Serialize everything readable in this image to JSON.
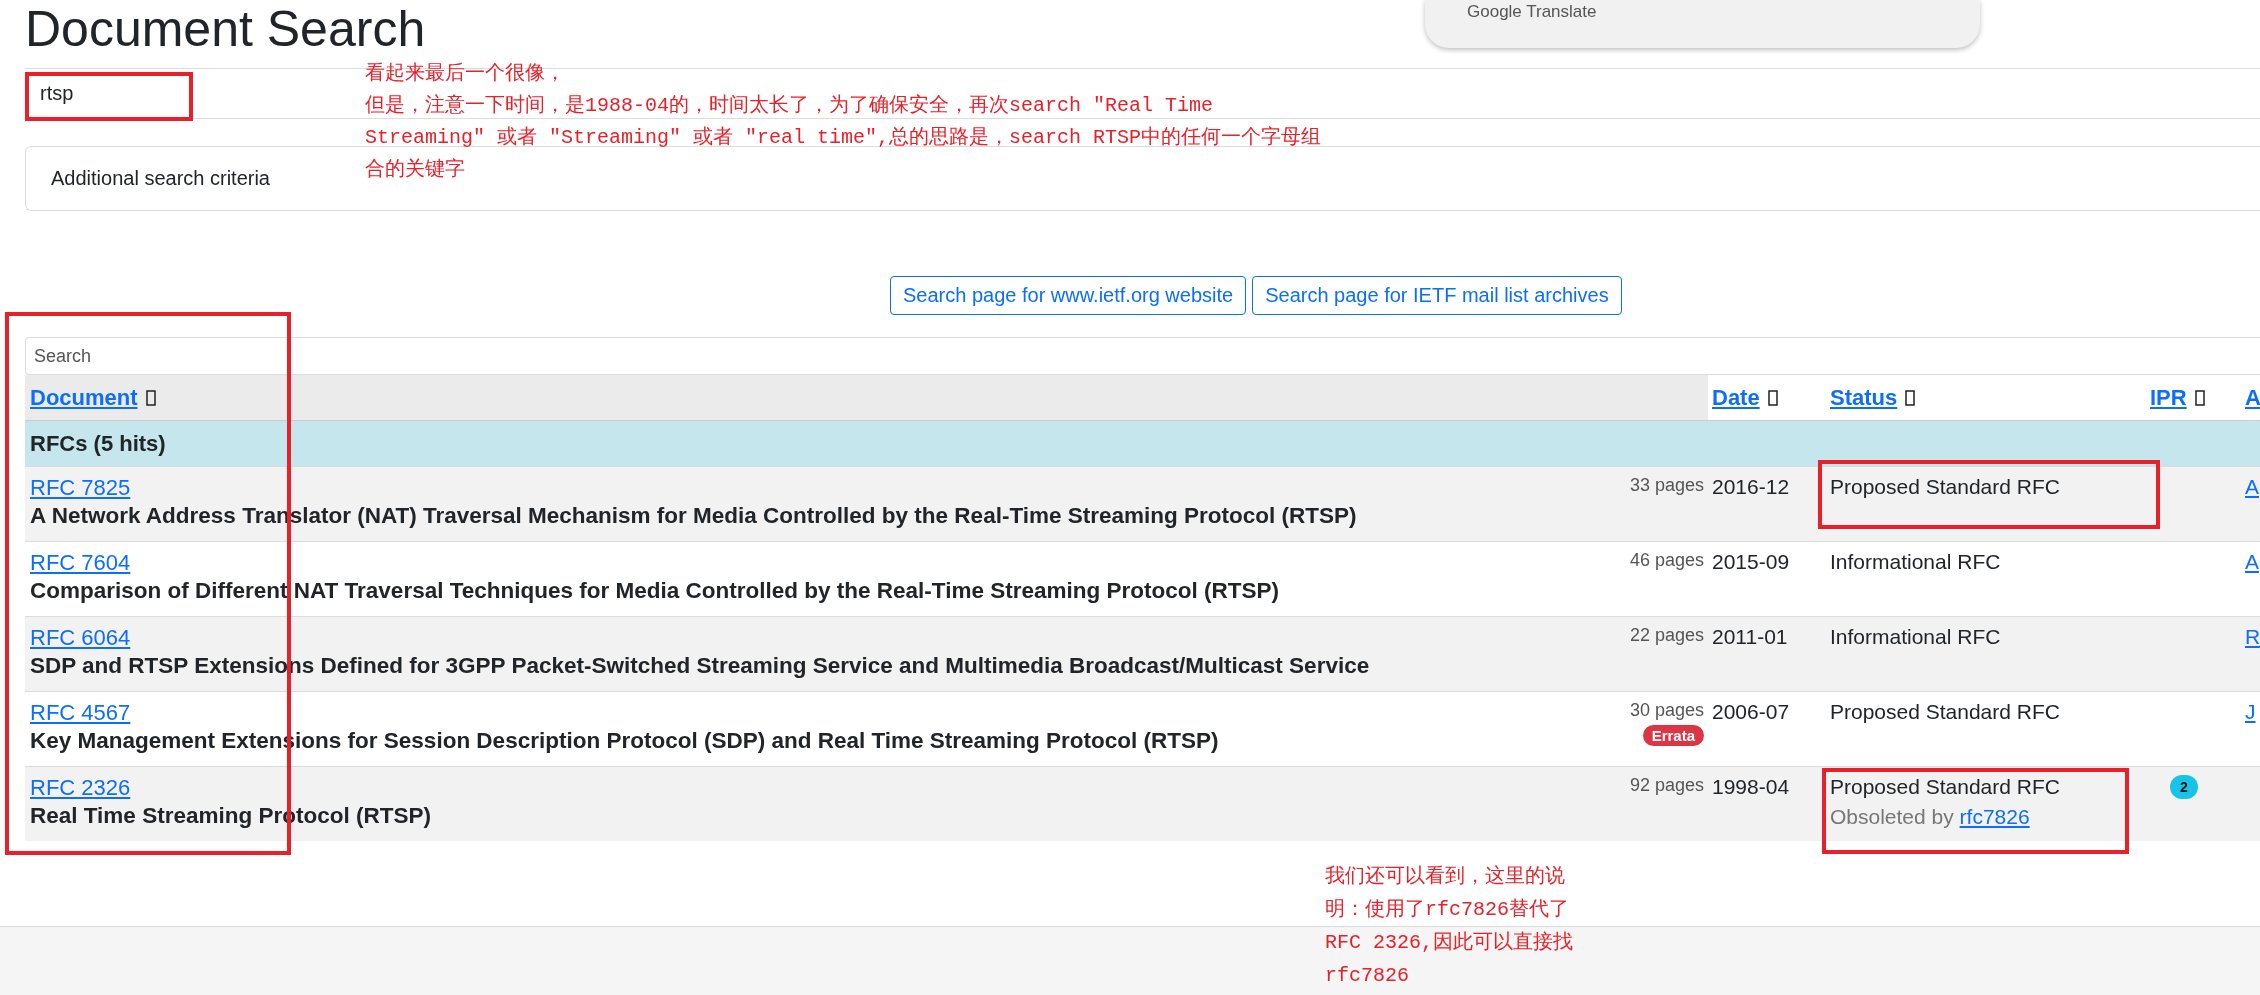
{
  "popup": {
    "title": "Google Translate"
  },
  "page_title": "Document Search",
  "query": {
    "value": "rtsp"
  },
  "criteria": {
    "label": "Additional search criteria"
  },
  "search_links": [
    "Search page for www.ietf.org website",
    "Search page for IETF mail list archives"
  ],
  "filter": {
    "placeholder": "Search"
  },
  "table": {
    "columns": [
      {
        "label": "Document"
      },
      {
        "label": "Date"
      },
      {
        "label": "Status"
      },
      {
        "label": "IPR"
      },
      {
        "label": "A"
      }
    ],
    "group": "RFCs (5 hits)",
    "rows": [
      {
        "number": "RFC 7825",
        "title": "A Network Address Translator (NAT) Traversal Mechanism for Media Controlled by the Real-Time Streaming Protocol (RTSP)",
        "pages": "33 pages",
        "date": "2016-12",
        "status": "Proposed Standard RFC",
        "author": "A"
      },
      {
        "number": "RFC 7604",
        "title": "Comparison of Different NAT Traversal Techniques for Media Controlled by the Real-Time Streaming Protocol (RTSP)",
        "pages": "46 pages",
        "date": "2015-09",
        "status": "Informational RFC",
        "author": "A"
      },
      {
        "number": "RFC 6064",
        "title": "SDP and RTSP Extensions Defined for 3GPP Packet-Switched Streaming Service and Multimedia Broadcast/Multicast Service",
        "pages": "22 pages",
        "date": "2011-01",
        "status": "Informational RFC",
        "author": "R"
      },
      {
        "number": "RFC 4567",
        "title": "Key Management Extensions for Session Description Protocol (SDP) and Real Time Streaming Protocol (RTSP)",
        "pages": "30 pages",
        "badge": "Errata",
        "date": "2006-07",
        "status": "Proposed Standard RFC",
        "author": "J"
      },
      {
        "number": "RFC 2326",
        "title": "Real Time Streaming Protocol (RTSP)",
        "pages": "92 pages",
        "date": "1998-04",
        "status": "Proposed Standard RFC",
        "obsoleted_label": "Obsoleted by",
        "obsoleted_link": "rfc7826",
        "ipr": "2"
      }
    ]
  },
  "notes": [
    {
      "lines": [
        "看起来最后一个很像，",
        "但是，注意一下时间，是1988-04的，时间太长了，为了确保安全，再次search ″Real Time",
        "Streaming″ 或者 ″Streaming″ 或者 ″real time″,总的思路是，search RTSP中的任何一个字母组",
        "合的关键字"
      ]
    },
    {
      "lines": [
        "我们还可以看到，这里的说",
        "明：使用了rfc7826替代了",
        "RFC 2326,因此可以直接找",
        "rfc7826"
      ]
    }
  ]
}
